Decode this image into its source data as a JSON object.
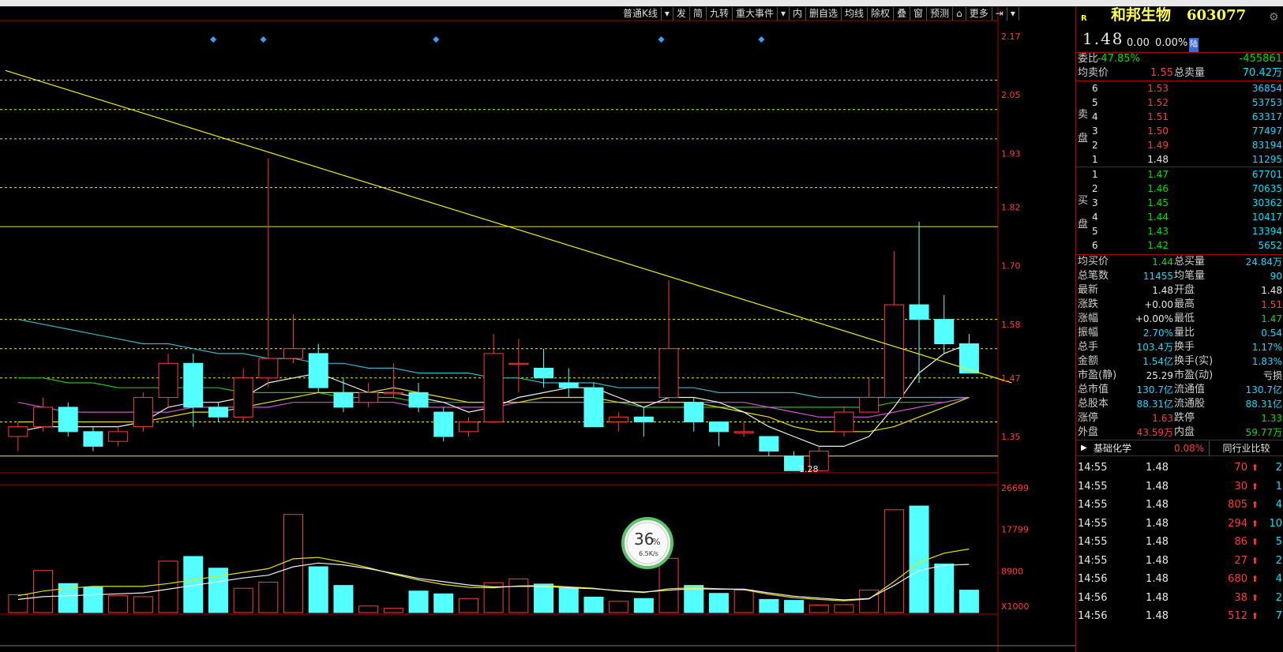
{
  "toolbar": {
    "items": [
      "普通K线",
      "▾",
      "发",
      "简",
      "九转",
      "重大事件",
      "▾",
      "内",
      "删自选",
      "均线",
      "除权",
      "叠",
      "窗",
      "预测",
      "⌂",
      "更多",
      "⇥",
      "▾"
    ]
  },
  "price_axis": {
    "labels": [
      "2.17",
      "2.05",
      "1.93",
      "1.82",
      "1.70",
      "1.58",
      "1.47",
      "1.35"
    ],
    "values": [
      2.17,
      2.05,
      1.93,
      1.82,
      1.7,
      1.58,
      1.47,
      1.35
    ]
  },
  "vol_axis": {
    "labels": [
      "26699",
      "17799",
      "8900",
      "X1000"
    ],
    "values": [
      26699,
      17799,
      8900
    ]
  },
  "low_marker": "1.28",
  "speed_widget": {
    "percent": "36",
    "unit": "%",
    "rate": "6.5K/s",
    "value": 0.36
  },
  "chart_data": {
    "type": "candlestick",
    "title": "和邦生物 603077",
    "ylim": [
      1.26,
      2.2
    ],
    "candles": [
      {
        "o": 1.35,
        "c": 1.37,
        "h": 1.38,
        "l": 1.32
      },
      {
        "o": 1.37,
        "c": 1.41,
        "h": 1.43,
        "l": 1.36
      },
      {
        "o": 1.41,
        "c": 1.36,
        "h": 1.42,
        "l": 1.35
      },
      {
        "o": 1.36,
        "c": 1.33,
        "h": 1.37,
        "l": 1.32
      },
      {
        "o": 1.34,
        "c": 1.36,
        "h": 1.37,
        "l": 1.33
      },
      {
        "o": 1.37,
        "c": 1.43,
        "h": 1.44,
        "l": 1.36
      },
      {
        "o": 1.43,
        "c": 1.5,
        "h": 1.52,
        "l": 1.41
      },
      {
        "o": 1.5,
        "c": 1.41,
        "h": 1.52,
        "l": 1.37
      },
      {
        "o": 1.41,
        "c": 1.39,
        "h": 1.42,
        "l": 1.38
      },
      {
        "o": 1.39,
        "c": 1.47,
        "h": 1.49,
        "l": 1.38
      },
      {
        "o": 1.47,
        "c": 1.51,
        "h": 1.92,
        "l": 1.45
      },
      {
        "o": 1.51,
        "c": 1.53,
        "h": 1.6,
        "l": 1.5
      },
      {
        "o": 1.52,
        "c": 1.45,
        "h": 1.54,
        "l": 1.44
      },
      {
        "o": 1.44,
        "c": 1.41,
        "h": 1.47,
        "l": 1.4
      },
      {
        "o": 1.42,
        "c": 1.44,
        "h": 1.46,
        "l": 1.41
      },
      {
        "o": 1.44,
        "c": 1.44,
        "h": 1.5,
        "l": 1.43
      },
      {
        "o": 1.44,
        "c": 1.41,
        "h": 1.46,
        "l": 1.4
      },
      {
        "o": 1.4,
        "c": 1.35,
        "h": 1.41,
        "l": 1.34
      },
      {
        "o": 1.36,
        "c": 1.38,
        "h": 1.39,
        "l": 1.35
      },
      {
        "o": 1.38,
        "c": 1.52,
        "h": 1.56,
        "l": 1.38
      },
      {
        "o": 1.5,
        "c": 1.5,
        "h": 1.55,
        "l": 1.44
      },
      {
        "o": 1.49,
        "c": 1.47,
        "h": 1.53,
        "l": 1.45
      },
      {
        "o": 1.46,
        "c": 1.45,
        "h": 1.49,
        "l": 1.43
      },
      {
        "o": 1.45,
        "c": 1.37,
        "h": 1.46,
        "l": 1.37
      },
      {
        "o": 1.38,
        "c": 1.39,
        "h": 1.4,
        "l": 1.36
      },
      {
        "o": 1.39,
        "c": 1.38,
        "h": 1.41,
        "l": 1.35
      },
      {
        "o": 1.43,
        "c": 1.53,
        "h": 1.67,
        "l": 1.42
      },
      {
        "o": 1.42,
        "c": 1.38,
        "h": 1.43,
        "l": 1.36
      },
      {
        "o": 1.38,
        "c": 1.36,
        "h": 1.38,
        "l": 1.33
      },
      {
        "o": 1.36,
        "c": 1.36,
        "h": 1.38,
        "l": 1.35
      },
      {
        "o": 1.35,
        "c": 1.32,
        "h": 1.35,
        "l": 1.31
      },
      {
        "o": 1.31,
        "c": 1.28,
        "h": 1.32,
        "l": 1.28
      },
      {
        "o": 1.28,
        "c": 1.32,
        "h": 1.33,
        "l": 1.28
      },
      {
        "o": 1.36,
        "c": 1.4,
        "h": 1.41,
        "l": 1.35
      },
      {
        "o": 1.4,
        "c": 1.43,
        "h": 1.47,
        "l": 1.4
      },
      {
        "o": 1.43,
        "c": 1.62,
        "h": 1.73,
        "l": 1.43
      },
      {
        "o": 1.62,
        "c": 1.59,
        "h": 1.79,
        "l": 1.46
      },
      {
        "o": 1.59,
        "c": 1.54,
        "h": 1.64,
        "l": 1.52
      },
      {
        "o": 1.54,
        "c": 1.48,
        "h": 1.56,
        "l": 1.48
      }
    ],
    "volumes": [
      3.8,
      9.0,
      6.2,
      5.4,
      3.6,
      3.4,
      11.0,
      12.0,
      9.5,
      5.2,
      6.5,
      21.0,
      9.8,
      5.8,
      1.4,
      0.9,
      4.6,
      4.0,
      3.0,
      6.4,
      7.2,
      6.1,
      5.2,
      3.3,
      2.4,
      3.0,
      11.6,
      5.8,
      4.1,
      4.8,
      2.8,
      2.6,
      1.6,
      1.7,
      4.8,
      22.0,
      22.8,
      10.4,
      4.8
    ],
    "ma_white": [
      1.36,
      1.37,
      1.37,
      1.37,
      1.37,
      1.38,
      1.41,
      1.42,
      1.42,
      1.43,
      1.46,
      1.47,
      1.48,
      1.46,
      1.44,
      1.44,
      1.43,
      1.42,
      1.4,
      1.41,
      1.43,
      1.44,
      1.45,
      1.45,
      1.43,
      1.41,
      1.43,
      1.43,
      1.42,
      1.4,
      1.37,
      1.35,
      1.33,
      1.33,
      1.35,
      1.41,
      1.48,
      1.52,
      1.54
    ],
    "ma_yellow": [
      1.38,
      1.38,
      1.38,
      1.38,
      1.38,
      1.38,
      1.39,
      1.4,
      1.4,
      1.41,
      1.42,
      1.43,
      1.44,
      1.44,
      1.44,
      1.45,
      1.44,
      1.43,
      1.42,
      1.42,
      1.42,
      1.43,
      1.43,
      1.43,
      1.42,
      1.42,
      1.42,
      1.42,
      1.41,
      1.4,
      1.39,
      1.37,
      1.36,
      1.36,
      1.36,
      1.37,
      1.39,
      1.41,
      1.43
    ],
    "ma_magenta": [
      1.42,
      1.41,
      1.4,
      1.4,
      1.4,
      1.4,
      1.4,
      1.41,
      1.41,
      1.41,
      1.41,
      1.42,
      1.42,
      1.42,
      1.42,
      1.42,
      1.41,
      1.41,
      1.41,
      1.41,
      1.42,
      1.42,
      1.42,
      1.42,
      1.42,
      1.42,
      1.42,
      1.42,
      1.42,
      1.42,
      1.41,
      1.4,
      1.39,
      1.39,
      1.39,
      1.4,
      1.41,
      1.42,
      1.43
    ],
    "ma_green": [
      1.47,
      1.47,
      1.46,
      1.46,
      1.45,
      1.45,
      1.45,
      1.45,
      1.45,
      1.44,
      1.44,
      1.44,
      1.44,
      1.43,
      1.43,
      1.43,
      1.42,
      1.42,
      1.42,
      1.42,
      1.42,
      1.42,
      1.42,
      1.42,
      1.42,
      1.41,
      1.41,
      1.41,
      1.41,
      1.41,
      1.41,
      1.41,
      1.41,
      1.41,
      1.41,
      1.42,
      1.42,
      1.42,
      1.43
    ],
    "ma_cyan": [
      1.59,
      1.58,
      1.57,
      1.56,
      1.55,
      1.54,
      1.54,
      1.53,
      1.52,
      1.52,
      1.51,
      1.51,
      1.5,
      1.5,
      1.49,
      1.49,
      1.48,
      1.48,
      1.48,
      1.47,
      1.47,
      1.46,
      1.46,
      1.46,
      1.45,
      1.45,
      1.45,
      1.45,
      1.44,
      1.44,
      1.44,
      1.44,
      1.43,
      1.43,
      1.43,
      1.43,
      1.43,
      1.43,
      1.43
    ],
    "vol_ma_white": [
      2.8,
      3.4,
      3.6,
      3.8,
      4.0,
      4.2,
      5.0,
      5.8,
      6.6,
      7.4,
      8.0,
      9.8,
      10.6,
      10.2,
      9.4,
      8.4,
      7.3,
      6.6,
      5.9,
      5.5,
      5.6,
      5.6,
      5.3,
      5.1,
      4.7,
      4.4,
      4.8,
      5.1,
      5.0,
      5.0,
      4.2,
      3.5,
      3.1,
      2.7,
      3.0,
      5.8,
      9.0,
      10.1,
      10.3
    ],
    "vol_ma_yellow": [
      3.6,
      4.6,
      5.2,
      5.6,
      5.6,
      5.6,
      6.2,
      7.0,
      7.8,
      8.6,
      9.4,
      11.5,
      11.8,
      10.8,
      9.6,
      8.2,
      7.0,
      6.0,
      5.4,
      5.3,
      5.7,
      5.8,
      5.5,
      5.2,
      4.6,
      4.3,
      5.1,
      5.3,
      5.1,
      4.9,
      3.9,
      3.2,
      2.8,
      2.5,
      2.9,
      6.6,
      10.7,
      12.7,
      13.6
    ],
    "trendline": {
      "from": {
        "i": -0.5,
        "price": 2.1
      },
      "to": {
        "i": 39.7,
        "price": 1.46
      }
    },
    "h_lines_yellow_solid": [
      1.78,
      1.31
    ],
    "h_lines_dashed": [
      2.08,
      2.02,
      1.96,
      1.86,
      1.59,
      1.53,
      1.47,
      1.38
    ],
    "event_markers": [
      7.8,
      9.8,
      16.7,
      25.7,
      29.7
    ]
  },
  "quote": {
    "badge": "R",
    "name": "和邦生物",
    "code": "603077",
    "price": "1.48",
    "change": "0.00",
    "change_pct": "0.00%",
    "market_tag": "陆",
    "weibi_label": "委比",
    "weibi": "-47.85%",
    "weicha": "-455861",
    "avg_sell_label": "均卖价",
    "avg_sell": "1.55",
    "total_sell_label": "总卖量",
    "total_sell": "70.42万",
    "sell_side_label": [
      "卖",
      "盘"
    ],
    "sell": [
      {
        "lvl": "6",
        "price": "1.53",
        "vol": "36854"
      },
      {
        "lvl": "5",
        "price": "1.52",
        "vol": "53753"
      },
      {
        "lvl": "4",
        "price": "1.51",
        "vol": "63317"
      },
      {
        "lvl": "3",
        "price": "1.50",
        "vol": "77497"
      },
      {
        "lvl": "2",
        "price": "1.49",
        "vol": "83194"
      },
      {
        "lvl": "1",
        "price": "1.48",
        "vol": "11295"
      }
    ],
    "buy_side_label": [
      "买",
      "盘"
    ],
    "buy": [
      {
        "lvl": "1",
        "price": "1.47",
        "vol": "67701"
      },
      {
        "lvl": "2",
        "price": "1.46",
        "vol": "70635"
      },
      {
        "lvl": "3",
        "price": "1.45",
        "vol": "30362"
      },
      {
        "lvl": "4",
        "price": "1.44",
        "vol": "10417"
      },
      {
        "lvl": "5",
        "price": "1.43",
        "vol": "13394"
      },
      {
        "lvl": "6",
        "price": "1.42",
        "vol": "5652"
      }
    ],
    "stats": [
      {
        "l1": "均买价",
        "v1": "1.44",
        "c1": "green",
        "l2": "总买量",
        "v2": "24.84万",
        "c2": "cyan"
      },
      {
        "l1": "总笔数",
        "v1": "11455",
        "c1": "cyan",
        "l2": "均笔量",
        "v2": "90",
        "c2": "cyan"
      },
      {
        "l1": "最新",
        "v1": "1.48",
        "c1": "white",
        "l2": "开盘",
        "v2": "1.48",
        "c2": "white"
      },
      {
        "l1": "涨跌",
        "v1": "+0.00",
        "c1": "white",
        "l2": "最高",
        "v2": "1.51",
        "c2": "red"
      },
      {
        "l1": "涨幅",
        "v1": "+0.00%",
        "c1": "white",
        "l2": "最低",
        "v2": "1.47",
        "c2": "green"
      },
      {
        "l1": "振幅",
        "v1": "2.70%",
        "c1": "cyan",
        "l2": "量比",
        "v2": "0.54",
        "c2": "cyan"
      },
      {
        "l1": "总手",
        "v1": "103.4万",
        "c1": "cyan",
        "l2": "换手",
        "v2": "1.17%",
        "c2": "cyan"
      },
      {
        "l1": "金额",
        "v1": "1.54亿",
        "c1": "cyan",
        "l2": "换手(实)",
        "v2": "1.83%",
        "c2": "cyan"
      },
      {
        "l1": "市盈(静)",
        "v1": "25.29",
        "c1": "white",
        "l2": "市盈(动)",
        "v2": "亏损",
        "c2": "white"
      },
      {
        "l1": "总市值",
        "v1": "130.7亿",
        "c1": "cyan",
        "l2": "流通值",
        "v2": "130.7亿",
        "c2": "cyan"
      },
      {
        "l1": "总股本",
        "v1": "88.31亿",
        "c1": "cyan",
        "l2": "流通股",
        "v2": "88.31亿",
        "c2": "cyan"
      },
      {
        "l1": "涨停",
        "v1": "1.63",
        "c1": "red",
        "l2": "跌停",
        "v2": "1.33",
        "c2": "green"
      },
      {
        "l1": "外盘",
        "v1": "43.59万",
        "c1": "red",
        "l2": "内盘",
        "v2": "59.77万",
        "c2": "green"
      }
    ],
    "sector": {
      "name": "基础化学",
      "pct": "0.08%",
      "compare": "同行业比较"
    },
    "ticks": [
      {
        "time": "14:55",
        "price": "1.48",
        "vol": "70",
        "n": "2"
      },
      {
        "time": "14:55",
        "price": "1.48",
        "vol": "30",
        "n": "1"
      },
      {
        "time": "14:55",
        "price": "1.48",
        "vol": "805",
        "n": "4"
      },
      {
        "time": "14:55",
        "price": "1.48",
        "vol": "294",
        "n": "10"
      },
      {
        "time": "14:55",
        "price": "1.48",
        "vol": "86",
        "n": "5"
      },
      {
        "time": "14:55",
        "price": "1.48",
        "vol": "27",
        "n": "2"
      },
      {
        "time": "14:56",
        "price": "1.48",
        "vol": "680",
        "n": "4"
      },
      {
        "time": "14:56",
        "price": "1.48",
        "vol": "38",
        "n": "2"
      },
      {
        "time": "14:56",
        "price": "1.48",
        "vol": "512",
        "n": "7"
      }
    ]
  },
  "colors": {
    "up": "#ff3b3b",
    "down": "#54ffff",
    "grid": "#b00000",
    "yellow": "#f0f000"
  }
}
